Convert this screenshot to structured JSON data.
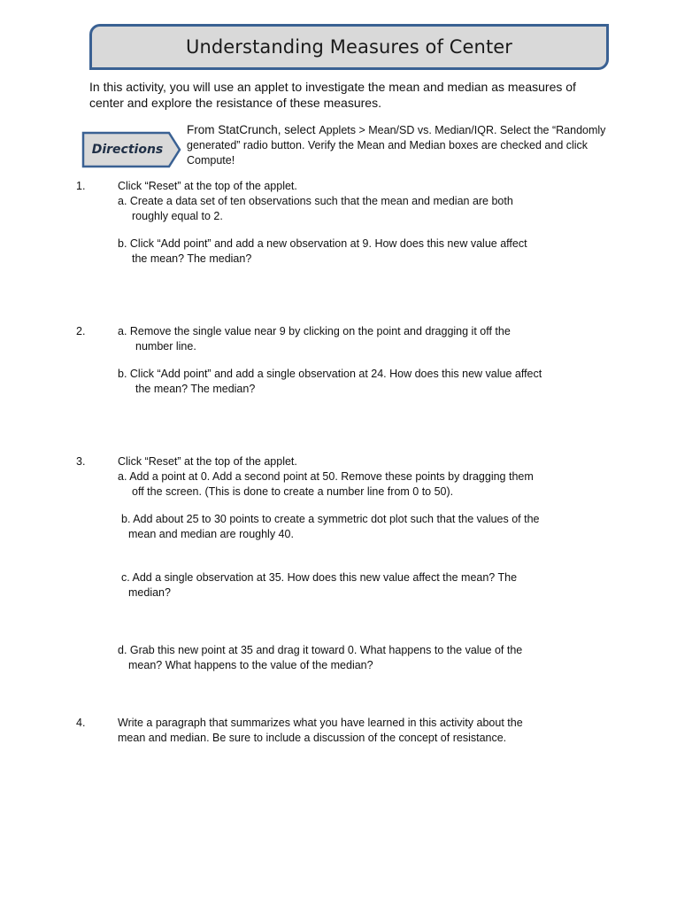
{
  "document": {
    "title": "Understanding Measures of Center",
    "intro": "In this activity, you will use an applet to investigate the mean and median as measures of center and explore the resistance of these measures.",
    "directions": {
      "badge_label": "Directions",
      "text_lead": "From StatCrunch, select ",
      "text_rest": "Applets > Mean/SD vs. Median/IQR. Select the “Randomly generated” radio button. Verify the Mean and Median boxes are checked and click Compute!"
    },
    "questions": [
      {
        "number": "1.",
        "intro": "Click “Reset” at the top of the applet.",
        "parts": [
          {
            "line1": "a. Create a data set of ten observations such that the mean and median are both",
            "line2": "roughly equal to 2."
          },
          {
            "line1": "b. Click “Add point” and add a new observation at 9. How does this new value affect",
            "line2": "the mean? The median?"
          }
        ]
      },
      {
        "number": "2.",
        "parts": [
          {
            "line1": "a. Remove the single value near 9 by clicking on the point and dragging it off the",
            "line2": "number line."
          },
          {
            "line1": "b. Click “Add point” and add a single observation at 24. How does this new value affect",
            "line2": "the mean? The median?"
          }
        ]
      },
      {
        "number": "3.",
        "intro": "Click “Reset” at the top of the applet.",
        "parts": [
          {
            "line1": "a. Add a point at 0. Add a second point at 50. Remove these points by dragging them",
            "line2": "off the screen. (This is done to create a number line from 0 to 50)."
          },
          {
            "line1": "b. Add about 25 to 30 points to create a symmetric dot plot such that the values of the",
            "line2": "mean and median are roughly 40."
          },
          {
            "line1": "c. Add a single observation at 35. How does this new value affect the mean? The",
            "line2": "median?"
          },
          {
            "line1": "d. Grab this new point at 35 and drag it toward 0. What happens to the value of the",
            "line2": "mean? What happens to the value of the median?"
          }
        ]
      },
      {
        "number": "4.",
        "line1": "Write a paragraph that summarizes what you have learned in this activity about the",
        "line2": "mean and median. Be sure to include a discussion of the concept of resistance."
      }
    ]
  },
  "colors": {
    "title_border": "#3a6193",
    "title_fill": "#d9d9d9",
    "badge_border": "#3a6193",
    "badge_fill": "#d9d9d9",
    "badge_text": "#1f2f46"
  }
}
